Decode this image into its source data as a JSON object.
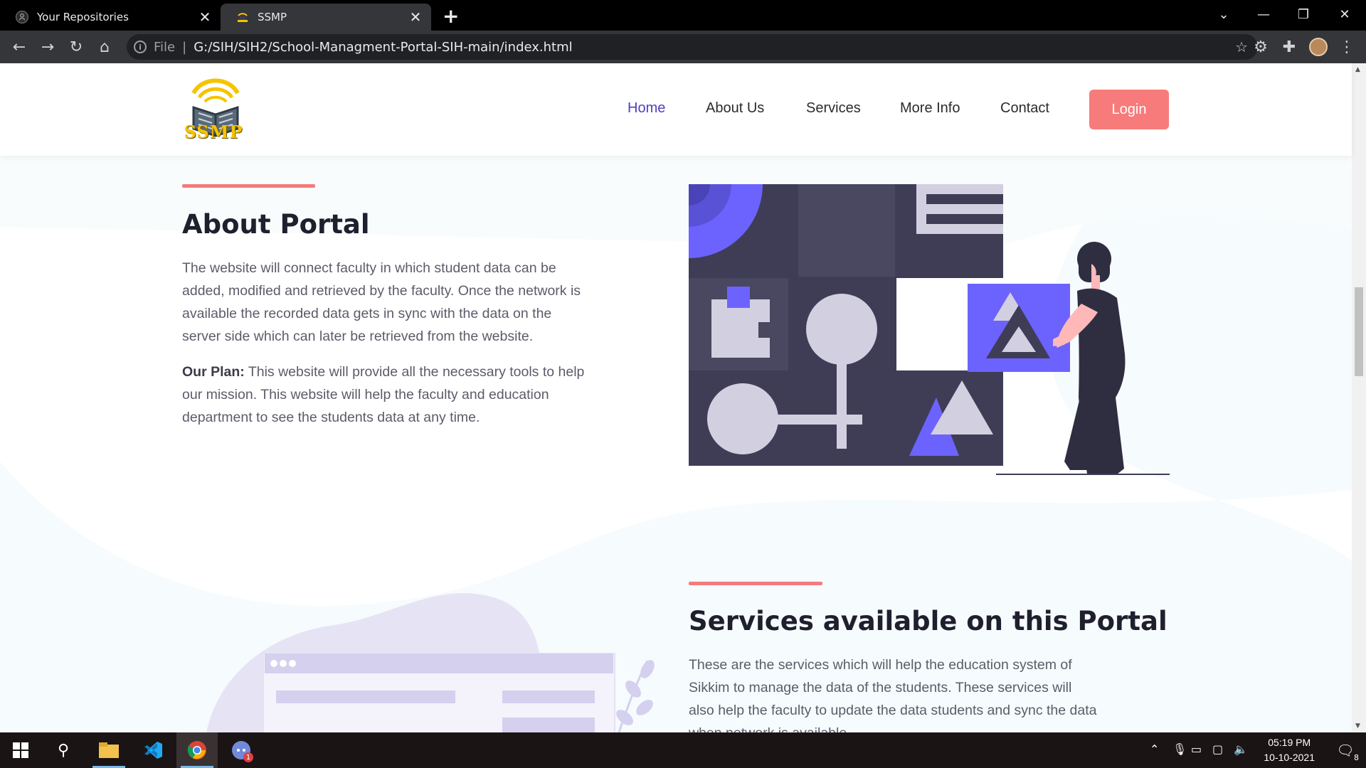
{
  "browser": {
    "tabs": [
      {
        "title": "Your Repositories",
        "active": false
      },
      {
        "title": "SSMP",
        "active": true
      }
    ],
    "address": {
      "scheme": "File",
      "url": "G:/SIH/SIH2/School-Managment-Portal-SIH-main/index.html"
    }
  },
  "site": {
    "logo_text": "SSMP",
    "nav": [
      {
        "label": "Home",
        "active": true
      },
      {
        "label": "About Us"
      },
      {
        "label": "Services"
      },
      {
        "label": "More Info"
      },
      {
        "label": "Contact"
      }
    ],
    "login_label": "Login",
    "about": {
      "title": "About Portal",
      "paragraph1_lines": [
        "The website will connect faculty in which student data can be",
        "added, modified and retrieved by the faculty. Once the network is",
        "available the recorded data gets in sync with the data on the",
        "server side which can later be retrieved from the website."
      ],
      "plan_label": "Our Plan:",
      "plan_lines": [
        " This website will provide all the necessary tools to help",
        "our mission. This website will help the faculty and education",
        "department to see the students data at any time."
      ]
    },
    "services": {
      "title": "Services available on this Portal",
      "lines": [
        "These are the services which will help the education system of",
        "Sikkim to manage the data of the students. These services will",
        "also help the faculty to update the data students and sync the data",
        "when network is available."
      ]
    }
  },
  "taskbar": {
    "time": "05:19 PM",
    "date": "10-10-2021",
    "notification_count": "8",
    "discord_badge": "1"
  },
  "colors": {
    "accent": "#f47b7b",
    "nav_active": "#4c3fbf",
    "illustration_purple": "#6c63ff",
    "illustration_dark": "#3f3d56"
  }
}
